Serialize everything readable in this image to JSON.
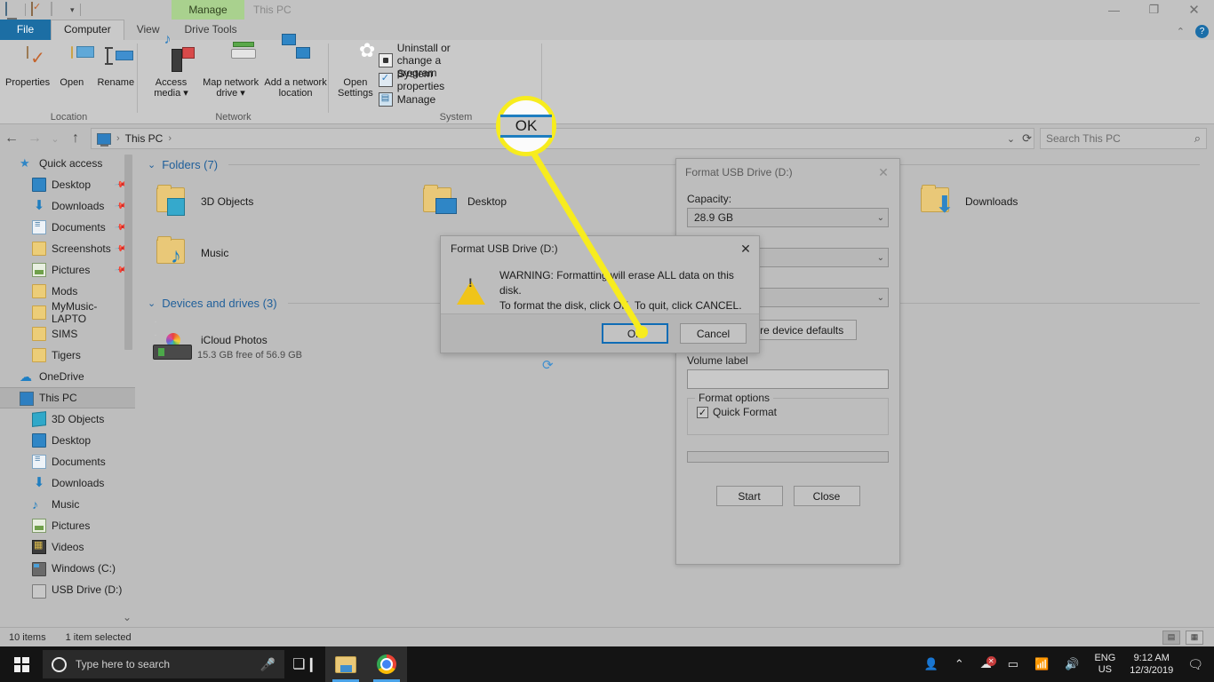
{
  "window": {
    "contextual_tab_group": "Manage",
    "title": "This PC",
    "minimize": "—",
    "maximize": "❐",
    "close": "✕"
  },
  "ribbon": {
    "tabs": [
      {
        "label": "File",
        "type": "file"
      },
      {
        "label": "Computer",
        "type": "active"
      },
      {
        "label": "View",
        "type": "normal"
      },
      {
        "label": "Drive Tools",
        "type": "normal"
      }
    ],
    "collapse_chevron": "⌃",
    "help_label": "?",
    "groups": [
      {
        "name": "Location",
        "buttons": [
          {
            "label": "Properties",
            "icon": "properties-icon"
          },
          {
            "label": "Open",
            "icon": "open-folder-icon"
          },
          {
            "label": "Rename",
            "icon": "rename-icon"
          }
        ]
      },
      {
        "name": "Network",
        "buttons": [
          {
            "label": "Access\nmedia ▾",
            "icon": "access-media-icon"
          },
          {
            "label": "Map network\ndrive ▾",
            "icon": "map-network-drive-icon"
          },
          {
            "label": "Add a network\nlocation",
            "icon": "add-network-location-icon"
          }
        ]
      },
      {
        "name": "System",
        "big_button": {
          "label": "Open\nSettings",
          "icon": "gear-icon"
        },
        "small_buttons": [
          {
            "label": "Uninstall or change a program",
            "icon": "uninstall-program-icon"
          },
          {
            "label": "System properties",
            "icon": "system-properties-icon"
          },
          {
            "label": "Manage",
            "icon": "manage-icon"
          }
        ]
      }
    ]
  },
  "addressbar": {
    "back": "←",
    "forward": "→",
    "recent": "⌄",
    "up": "↑",
    "breadcrumb": "This PC",
    "breadcrumb_sep": "›",
    "dropdown": "⌄",
    "refresh": "⟳",
    "search_placeholder": "Search This PC",
    "search_icon": "⌕"
  },
  "navpane": {
    "items": [
      {
        "label": "Quick access",
        "icon": "star-pin-icon",
        "level": 0,
        "pinned": false
      },
      {
        "label": "Desktop",
        "icon": "desktop-icon",
        "level": 1,
        "pinned": true
      },
      {
        "label": "Downloads",
        "icon": "downloads-icon",
        "level": 1,
        "pinned": true
      },
      {
        "label": "Documents",
        "icon": "documents-icon",
        "level": 1,
        "pinned": true
      },
      {
        "label": "Screenshots",
        "icon": "folder-icon",
        "level": 1,
        "pinned": true
      },
      {
        "label": "Pictures",
        "icon": "pictures-icon",
        "level": 1,
        "pinned": true
      },
      {
        "label": "Mods",
        "icon": "folder-icon",
        "level": 1,
        "pinned": false
      },
      {
        "label": "MyMusic-LAPTO",
        "icon": "folder-icon",
        "level": 1,
        "pinned": false
      },
      {
        "label": "SIMS",
        "icon": "folder-icon",
        "level": 1,
        "pinned": false
      },
      {
        "label": "Tigers",
        "icon": "folder-icon",
        "level": 1,
        "pinned": false
      },
      {
        "label": "OneDrive",
        "icon": "cloud-icon",
        "level": 0,
        "pinned": false
      },
      {
        "label": "This PC",
        "icon": "this-pc-icon",
        "level": 0,
        "pinned": false,
        "selected": true
      },
      {
        "label": "3D Objects",
        "icon": "3d-objects-icon",
        "level": 1,
        "pinned": false
      },
      {
        "label": "Desktop",
        "icon": "desktop-icon",
        "level": 1,
        "pinned": false
      },
      {
        "label": "Documents",
        "icon": "documents-icon",
        "level": 1,
        "pinned": false
      },
      {
        "label": "Downloads",
        "icon": "downloads-icon",
        "level": 1,
        "pinned": false
      },
      {
        "label": "Music",
        "icon": "music-icon",
        "level": 1,
        "pinned": false
      },
      {
        "label": "Pictures",
        "icon": "pictures-icon",
        "level": 1,
        "pinned": false
      },
      {
        "label": "Videos",
        "icon": "videos-icon",
        "level": 1,
        "pinned": false
      },
      {
        "label": "Windows (C:)",
        "icon": "hdd-icon",
        "level": 1,
        "pinned": false
      },
      {
        "label": "USB Drive (D:)",
        "icon": "usb-drive-icon",
        "level": 1,
        "pinned": false
      }
    ],
    "scroll_chevron": "⌄"
  },
  "content": {
    "groups": [
      {
        "header": "Folders (7)",
        "chevron": "⌄"
      },
      {
        "header": "Devices and drives (3)",
        "chevron": "⌄"
      }
    ],
    "folders": [
      {
        "label": "3D Objects",
        "icon": "folder-3d-objects-icon"
      },
      {
        "label": "Desktop",
        "icon": "folder-desktop-icon"
      },
      {
        "label": "Downloads",
        "icon": "folder-downloads-icon"
      },
      {
        "label": "Music",
        "icon": "folder-music-icon"
      }
    ],
    "sync_icon": "⟳",
    "devices": [
      {
        "label": "iCloud Photos",
        "icon": "icloud-photos-icon"
      }
    ],
    "drive_free_text": "15.3 GB free of 56.9 GB"
  },
  "statusbar": {
    "item_count": "10 items",
    "selection": "1 item selected",
    "details_view_icon": "▤",
    "large_icons_view_icon": "▦"
  },
  "taskbar": {
    "start_icon": "windows-logo",
    "search_placeholder": "Type here to search",
    "cortana_icon": "○",
    "mic_icon": "🎤",
    "task_view_icon": "taskview-icon",
    "apps": [
      {
        "name": "file-explorer",
        "running": true
      },
      {
        "name": "google-chrome",
        "running": true
      }
    ],
    "tray": {
      "people_icon": "people-icon",
      "overflow_icon": "⌃",
      "onedrive_icon": "cloud-error-icon",
      "battery_icon": "battery-icon",
      "network_icon": "wifi-icon",
      "volume_icon": "volume-icon",
      "language_line1": "ENG",
      "language_line2": "US",
      "time": "9:12 AM",
      "date": "12/3/2019",
      "action_center_icon": "notification-icon"
    }
  },
  "format_dialog": {
    "title": "Format USB Drive (D:)",
    "close": "✕",
    "capacity_label": "Capacity:",
    "capacity_value": "28.9 GB",
    "file_system_value": "",
    "allocation_value": "",
    "restore_defaults_label": "Restore device defaults",
    "volume_label_label": "Volume label",
    "volume_label_value": "",
    "format_options_label": "Format options",
    "quick_format_label": "Quick Format",
    "quick_format_checked": "✓",
    "start_label": "Start",
    "close_label": "Close",
    "chevron": "⌄"
  },
  "warning_dialog": {
    "title": "Format USB Drive (D:)",
    "close": "✕",
    "icon": "warning-triangle-icon",
    "bang": "!",
    "line1": "WARNING: Formatting will erase ALL data on this disk.",
    "line2": "To format the disk, click OK. To quit, click CANCEL.",
    "ok_label": "OK",
    "cancel_label": "Cancel"
  },
  "callout": {
    "label": "OK",
    "highlight_color": "#f7ec1e"
  }
}
